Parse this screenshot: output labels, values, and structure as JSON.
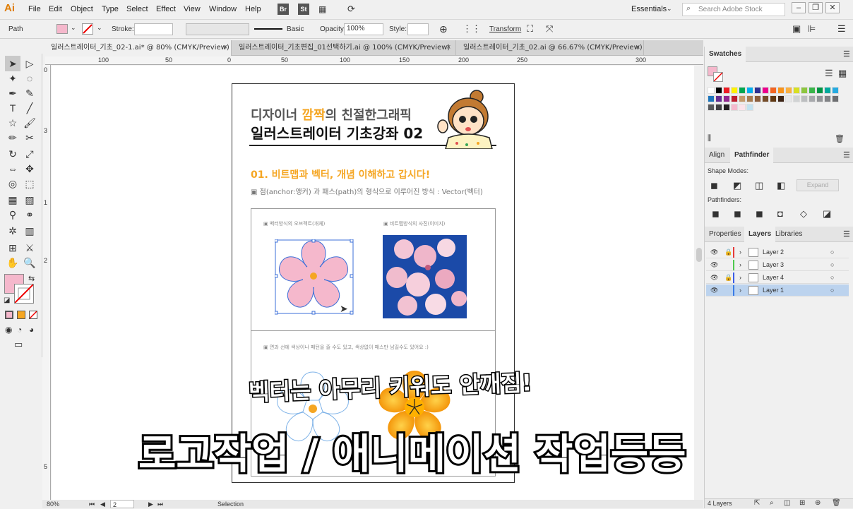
{
  "app": {
    "logo": "Ai"
  },
  "menu": [
    "File",
    "Edit",
    "Object",
    "Type",
    "Select",
    "Effect",
    "View",
    "Window",
    "Help"
  ],
  "menu_extras": {
    "br": "Br",
    "st": "St",
    "workspace": "Essentials",
    "search_placeholder": "Search Adobe Stock"
  },
  "control_bar": {
    "object_type": "Path",
    "stroke_label": "Stroke:",
    "brush": "Basic",
    "opacity_label": "Opacity:",
    "opacity_value": "100%",
    "style_label": "Style:",
    "transform": "Transform"
  },
  "tabs": [
    {
      "label": "일러스트레이터_기초_02-1.ai* @ 80% (CMYK/Preview)"
    },
    {
      "label": "일러스트레이터_기초편집_01선택하기.ai @ 100% (CMYK/Preview)"
    },
    {
      "label": "일러스트레이터_기초_02.ai @ 66.67% (CMYK/Preview)"
    }
  ],
  "ruler_h": [
    "100",
    "50",
    "0",
    "50",
    "100",
    "150",
    "200",
    "250",
    "300"
  ],
  "ruler_v": [
    "0",
    "3",
    "1",
    "2",
    "5"
  ],
  "artboard": {
    "subtitle_a": "디자이너 ",
    "subtitle_hl": "깜짝",
    "subtitle_b": "의 친절한그래픽",
    "title": "일러스트레이터 기초강좌 02",
    "section": "01. 비트맵과 벡터, 개념 이해하고 갑시다!",
    "desc": "▣ 점(anchor:앵커) 과 패스(path)의 형식으로 이루어진 방식 : Vector(벡터)",
    "vector_caption": "▣ 벡터방식의 오브젝트(개체)",
    "bitmap_caption": "▣ 비트맵방식의 사진(이미지)",
    "color_caption": "▣ 면과 선에 색상이나 패턴을 줄 수도 있고, 색상없이 패스만 남길수도 있어요 :)"
  },
  "subtitles": {
    "line1": "벡터는 아무리 키워도 안깨짐!",
    "line2": "로고작업 / 애니메이션 작업등등"
  },
  "status": {
    "zoom": "80%",
    "page": "2",
    "tool": "Selection"
  },
  "swatches": {
    "title": "Swatches"
  },
  "align_panel": {
    "tabs": [
      "Align",
      "Pathfinder"
    ],
    "shape_modes": "Shape Modes:",
    "expand": "Expand",
    "pathfinders": "Pathfinders:"
  },
  "layers_panel": {
    "tabs": [
      "Properties",
      "Layers",
      "Libraries"
    ],
    "layers": [
      {
        "name": "Layer 2",
        "color": "#e63b3b"
      },
      {
        "name": "Layer 3",
        "color": "#4ec94e"
      },
      {
        "name": "Layer 4",
        "color": "#3b5be6"
      },
      {
        "name": "Layer 1",
        "color": "#3b7be6"
      }
    ],
    "count": "4 Layers"
  },
  "colors": {
    "accent_orange": "#f5a623",
    "fill_pink": "#f5b8cc"
  }
}
